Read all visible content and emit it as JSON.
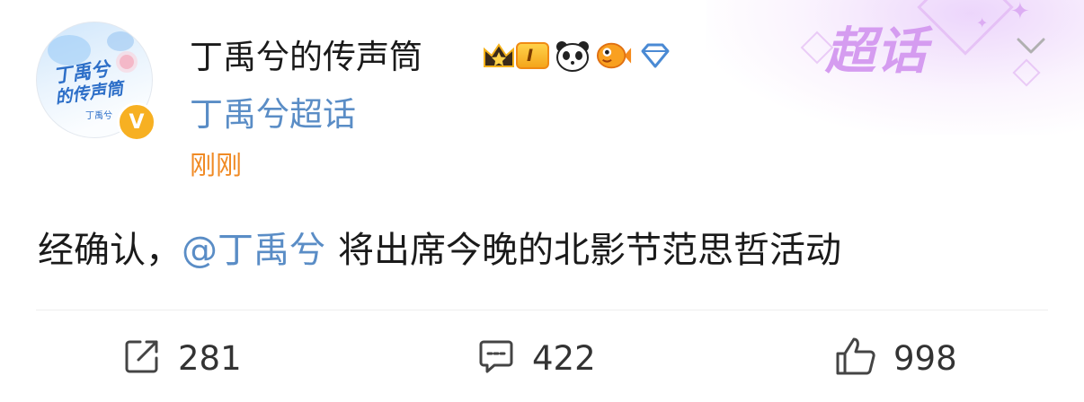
{
  "post": {
    "author_name": "丁禹兮的传声筒",
    "level_badge": "I",
    "supertopic": "丁禹兮超话",
    "time": "刚刚",
    "brand_label": "超话",
    "avatar": {
      "line1": "丁禹兮",
      "line2": "的传声筒",
      "line3": "丁禹兮"
    },
    "verified_mark": "V",
    "content_prefix": "经确认，",
    "mention": "@丁禹兮",
    "content_suffix": "将出席今晚的北影节范思哲活动"
  },
  "actions": {
    "repost_count": "281",
    "comment_count": "422",
    "like_count": "998"
  },
  "icons": [
    "crown-icon",
    "panda-icon",
    "fish-icon",
    "diamond-icon",
    "chevron-down-icon",
    "repost-icon",
    "comment-icon",
    "like-icon"
  ],
  "colors": {
    "link_blue": "#5a8dc6",
    "time_orange": "#f08a24",
    "brand_purple": "#d59cf0",
    "verified_gold": "#f7b022"
  }
}
